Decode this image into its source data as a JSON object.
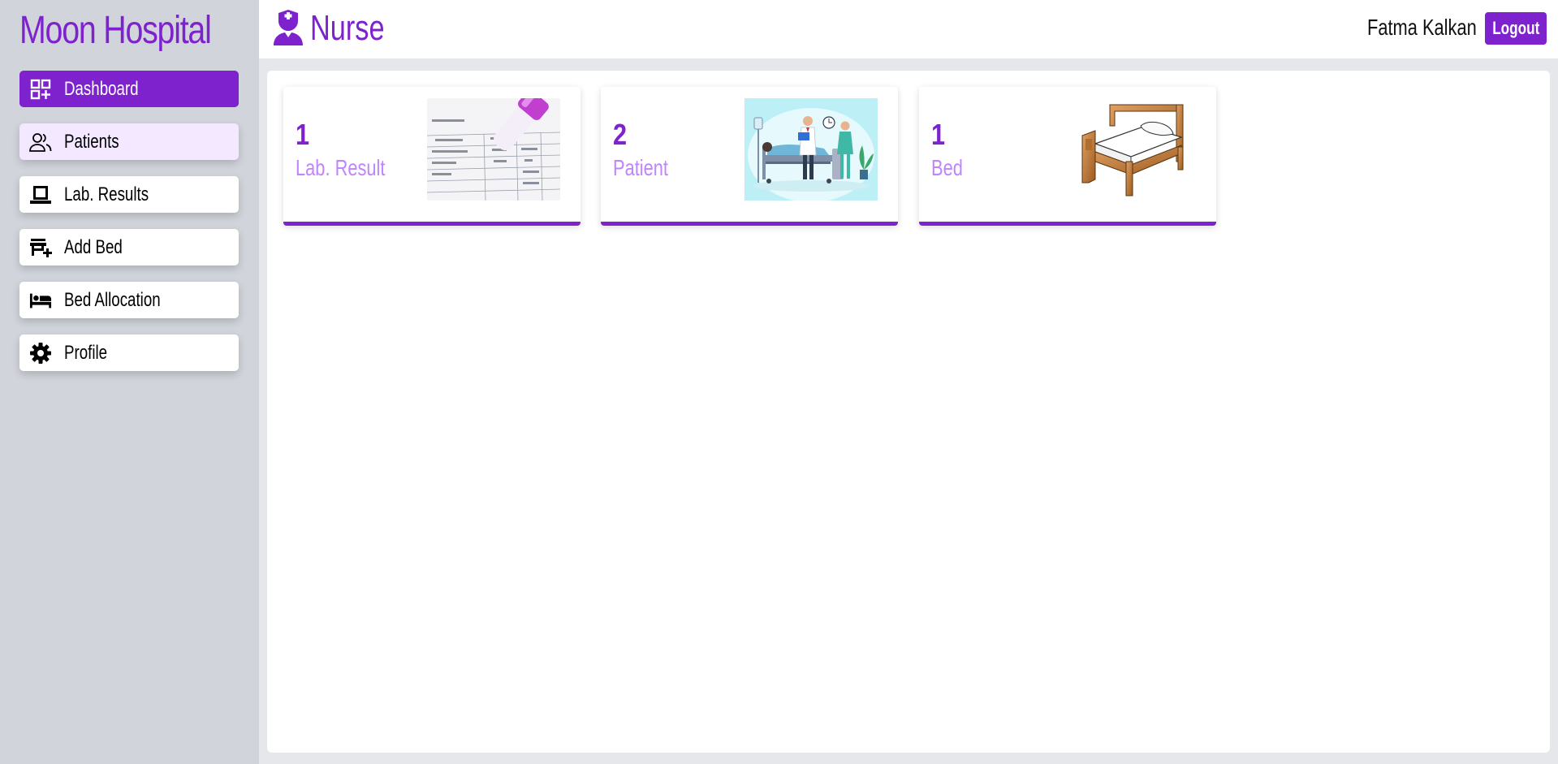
{
  "app": {
    "title": "Moon Hospital"
  },
  "header": {
    "role_title": "Nurse",
    "user_name": "Fatma Kalkan",
    "logout_label": "Logout"
  },
  "sidebar": {
    "items": [
      {
        "label": "Dashboard",
        "icon": "dashboard-icon",
        "state": "active"
      },
      {
        "label": "Patients",
        "icon": "users-icon",
        "state": "hover"
      },
      {
        "label": "Lab. Results",
        "icon": "laptop-icon",
        "state": "normal"
      },
      {
        "label": "Add Bed",
        "icon": "store-plus-icon",
        "state": "normal"
      },
      {
        "label": "Bed Allocation",
        "icon": "bed-icon",
        "state": "normal"
      },
      {
        "label": "Profile",
        "icon": "gear-icon",
        "state": "normal"
      }
    ]
  },
  "cards": [
    {
      "count": "1",
      "label": "Lab. Result",
      "image": "lab-result-image"
    },
    {
      "count": "2",
      "label": "Patient",
      "image": "patient-care-image"
    },
    {
      "count": "1",
      "label": "Bed",
      "image": "bed-image"
    }
  ],
  "colors": {
    "accent": "#7e22ce",
    "accent_light": "#c084fc",
    "sidebar_bg": "#d1d5db",
    "hover_bg": "#f3e8ff"
  }
}
